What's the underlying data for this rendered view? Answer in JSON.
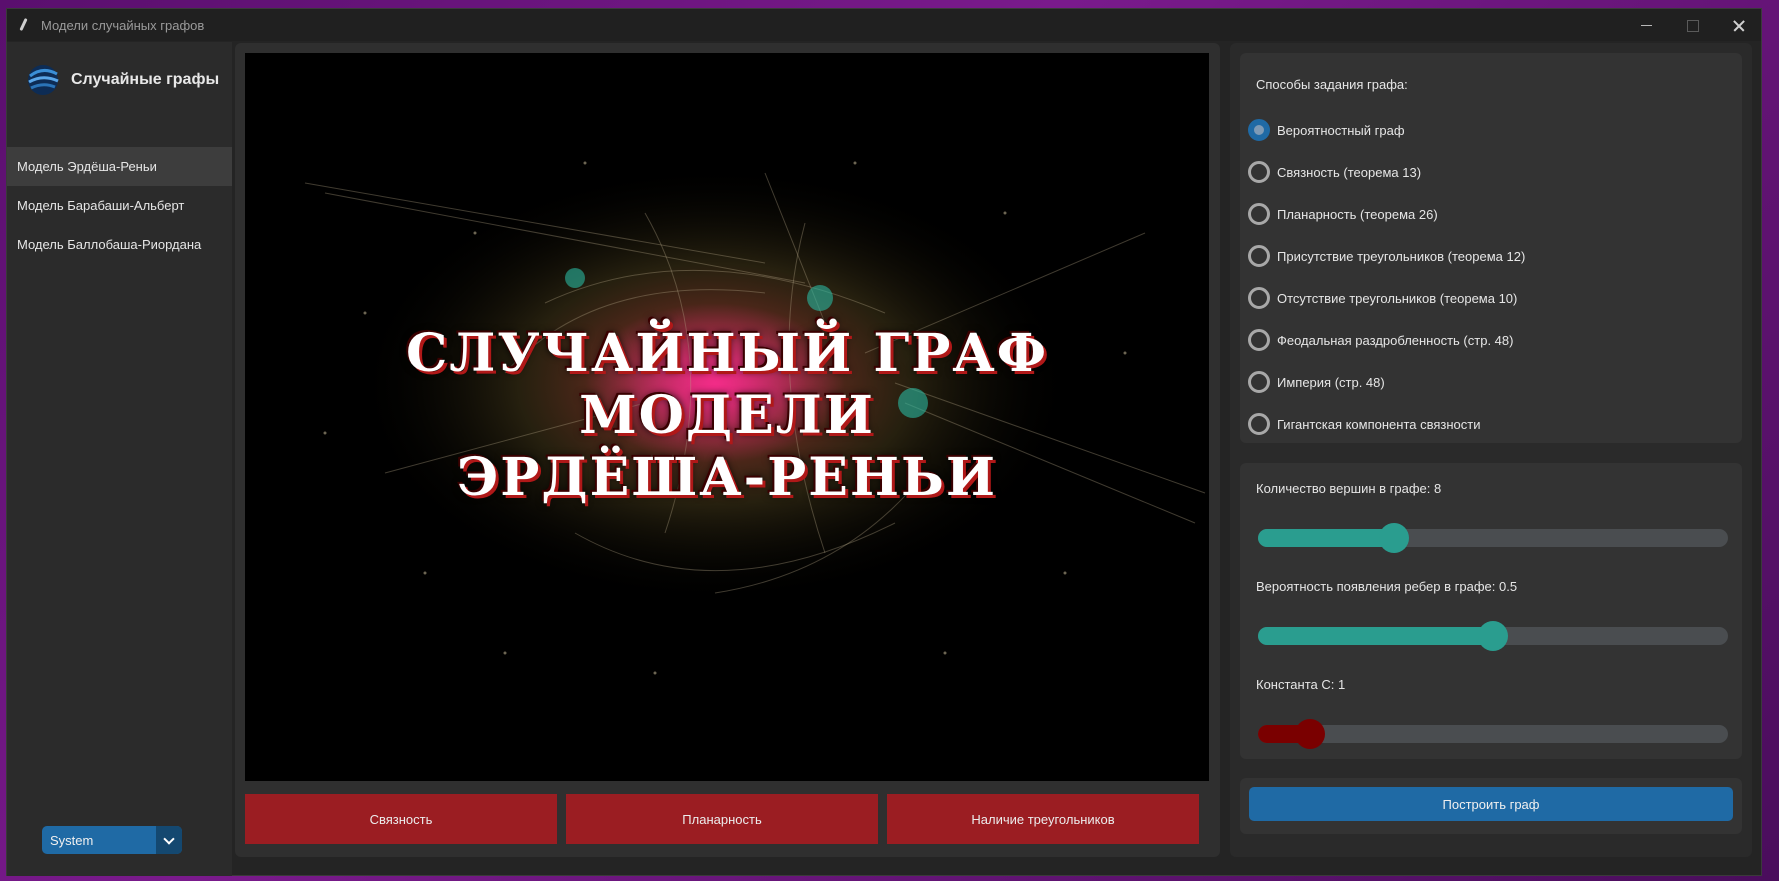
{
  "window": {
    "title": "Модели случайных графов"
  },
  "sidebar": {
    "logo_text": "Случайные графы",
    "items": [
      {
        "label": "Модель Эрдёша-Реньи",
        "active": true
      },
      {
        "label": "Модель Барабаши-Альберт",
        "active": false
      },
      {
        "label": "Модель Баллобаша-Риордана",
        "active": false
      }
    ],
    "theme_select": {
      "value": "System"
    }
  },
  "canvas": {
    "banner_lines": [
      "СЛУЧАЙНЫЙ ГРАФ",
      "МОДЕЛИ",
      "ЭРДЁША-РЕНЬИ"
    ]
  },
  "property_buttons": [
    "Связность",
    "Планарность",
    "Наличие треугольников"
  ],
  "right_panel": {
    "methods_title": "Способы задания графа:",
    "methods": [
      {
        "label": "Вероятностный граф",
        "selected": true
      },
      {
        "label": "Связность (теорема 13)",
        "selected": false
      },
      {
        "label": "Планарность (теорема 26)",
        "selected": false
      },
      {
        "label": "Присутствие треугольников (теорема 12)",
        "selected": false
      },
      {
        "label": "Отсутствие треугольников (теорема 10)",
        "selected": false
      },
      {
        "label": "Феодальная раздробленность (стр. 48)",
        "selected": false
      },
      {
        "label": "Империя (стр. 48)",
        "selected": false
      },
      {
        "label": "Гигантская компонента связности",
        "selected": false
      }
    ],
    "sliders": [
      {
        "label": "Количество вершин в графе: 8",
        "fraction": 0.29,
        "color": "#2a9d8f"
      },
      {
        "label": "Вероятность появления ребер в графе: 0.5",
        "fraction": 0.5,
        "color": "#2a9d8f"
      },
      {
        "label": "Константа C: 1",
        "fraction": 0.11,
        "color": "#7a0000"
      }
    ],
    "build_button": "Построить граф"
  },
  "colors": {
    "accent_blue": "#1f6aa5",
    "red_button": "#9b1d22",
    "teal": "#2a9d8f",
    "dark_red": "#7a0000"
  }
}
